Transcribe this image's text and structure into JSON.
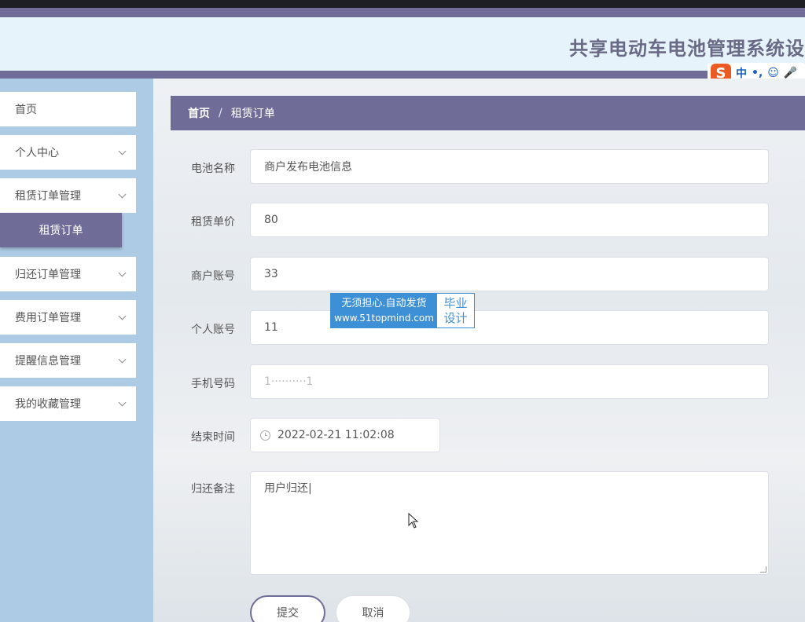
{
  "header": {
    "title": "共享电动车电池管理系统设"
  },
  "ime": {
    "logo": "S",
    "items": [
      "中",
      "•,",
      "☺",
      "🎤"
    ]
  },
  "sidebar": {
    "items": [
      {
        "label": "首页",
        "has_chevron": false
      },
      {
        "label": "个人中心",
        "has_chevron": true
      },
      {
        "label": "租赁订单管理",
        "has_chevron": true
      },
      {
        "label": "归还订单管理",
        "has_chevron": true
      },
      {
        "label": "费用订单管理",
        "has_chevron": true
      },
      {
        "label": "提醒信息管理",
        "has_chevron": true
      },
      {
        "label": "我的收藏管理",
        "has_chevron": true
      }
    ],
    "active_submenu": "租赁订单"
  },
  "breadcrumb": {
    "home": "首页",
    "separator": "/",
    "current": "租赁订单"
  },
  "form": {
    "battery_name": {
      "label": "电池名称",
      "value": "商户发布电池信息"
    },
    "unit_price": {
      "label": "租赁单价",
      "value": "80"
    },
    "merchant_account": {
      "label": "商户账号",
      "value": "33"
    },
    "personal_account": {
      "label": "个人账号",
      "value": "11"
    },
    "phone": {
      "label": "手机号码",
      "value": "1··········1"
    },
    "end_time": {
      "label": "结束时间",
      "value": "2022-02-21 11:02:08"
    },
    "return_note": {
      "label": "归还备注",
      "value": "用户归还|"
    }
  },
  "buttons": {
    "submit": "提交",
    "cancel": "取消"
  },
  "watermark": {
    "line1": "无须担心.自动发货",
    "line2": "www.51topmind.com",
    "right1": "毕业",
    "right2": "设计"
  },
  "colors": {
    "accent": "#6f6d97",
    "sidebar_bg": "#aecbe6",
    "header_bg": "#e6f3fb",
    "watermark_blue": "#3d8fd6"
  }
}
